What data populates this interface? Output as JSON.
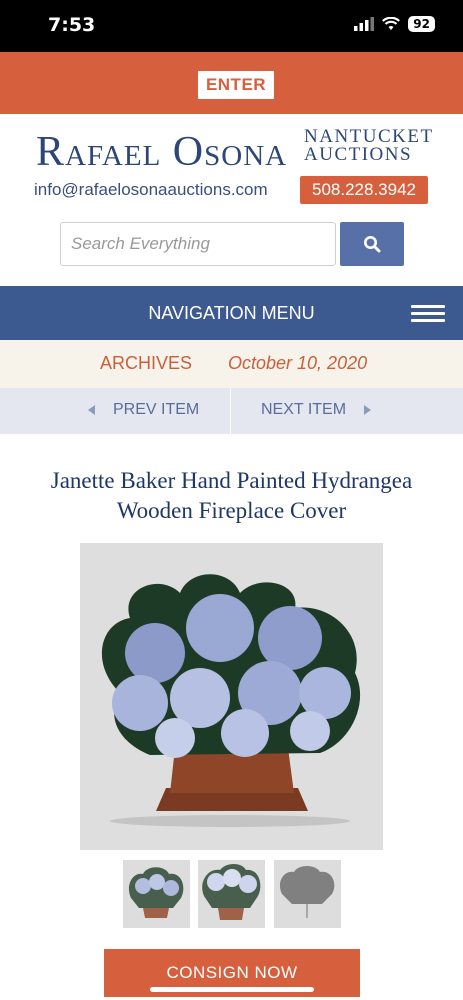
{
  "status_bar": {
    "time": "7:53",
    "battery": "92",
    "icons": [
      "signal-icon",
      "wifi-icon",
      "battery-icon"
    ]
  },
  "header": {
    "enter_label": "ENTER",
    "logo_main": "Rafael Osona",
    "logo_sub_line1": "NANTUCKET",
    "logo_sub_line2": "AUCTIONS",
    "email": "info@rafaelosonaauctions.com",
    "phone": "508.228.3942"
  },
  "search": {
    "placeholder": "Search Everything",
    "value": "",
    "button_icon": "search-icon"
  },
  "nav": {
    "label": "NAVIGATION MENU",
    "icon": "hamburger-icon"
  },
  "archive": {
    "label": "ARCHIVES",
    "date": "October 10, 2020"
  },
  "pager": {
    "prev": "PREV ITEM",
    "next": "NEXT ITEM"
  },
  "item": {
    "title": "Janette Baker Hand Painted Hydrangea Wooden Fireplace Cover"
  },
  "cta": {
    "consign": "CONSIGN NOW"
  },
  "colors": {
    "accent": "#d6603e",
    "navy": "#3d5a90",
    "title": "#1f3668"
  }
}
